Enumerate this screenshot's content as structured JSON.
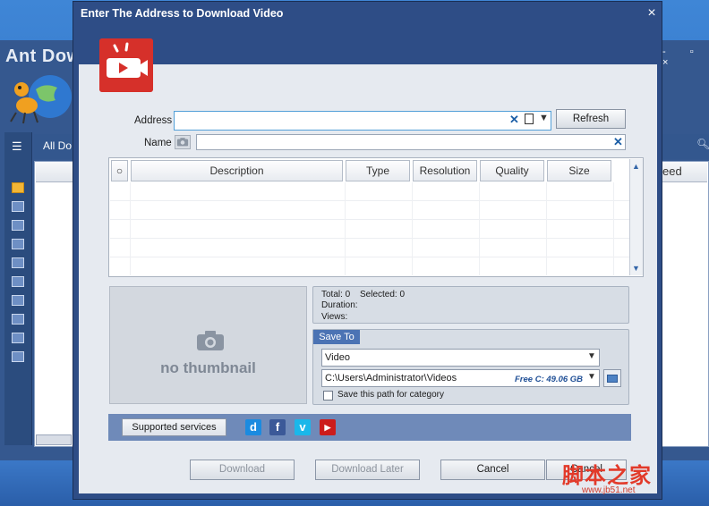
{
  "background_app": {
    "title": "Ant Down",
    "tab_label": "All Do",
    "speed_column": "eed"
  },
  "dialog": {
    "title": "Enter The Address to Download Video",
    "close_glyph": "×"
  },
  "address": {
    "label": "Address",
    "value": "",
    "clear_glyph": "✕",
    "dropdown_glyph": "▼",
    "refresh_label": "Refresh"
  },
  "name": {
    "label": "Name",
    "value": "",
    "clear_glyph": "✕"
  },
  "grid": {
    "columns": [
      "○",
      "Description",
      "Type",
      "Resolution",
      "Quality",
      "Size"
    ],
    "rows": []
  },
  "thumbnail": {
    "text": "no thumbnail"
  },
  "info": {
    "total_label": "Total: 0",
    "selected_label": "Selected: 0",
    "duration_label": "Duration:",
    "views_label": "Views:"
  },
  "save_to": {
    "tab_label": "Save To",
    "category": "Video",
    "path": "C:\\Users\\Administrator\\Videos",
    "free_space": "Free C: 49.06 GB",
    "save_path_label": "Save this path for category",
    "save_path_checked": false
  },
  "services": {
    "button_label": "Supported services",
    "icons": [
      "dailymotion-icon",
      "facebook-icon",
      "vimeo-icon",
      "youtube-icon"
    ],
    "glyphs": [
      "d",
      "f",
      "v",
      "▶"
    ]
  },
  "buttons": {
    "download": "Download",
    "download_later": "Download Later",
    "cancel": "Cancel",
    "cancel_partial": "Cancel"
  },
  "watermark": {
    "text": "脚本之家",
    "url": "www.jb51.net"
  },
  "colors": {
    "dialog_frame": "#2e4d86",
    "brand_red": "#d6302a",
    "accent_blue": "#4b73b4"
  }
}
